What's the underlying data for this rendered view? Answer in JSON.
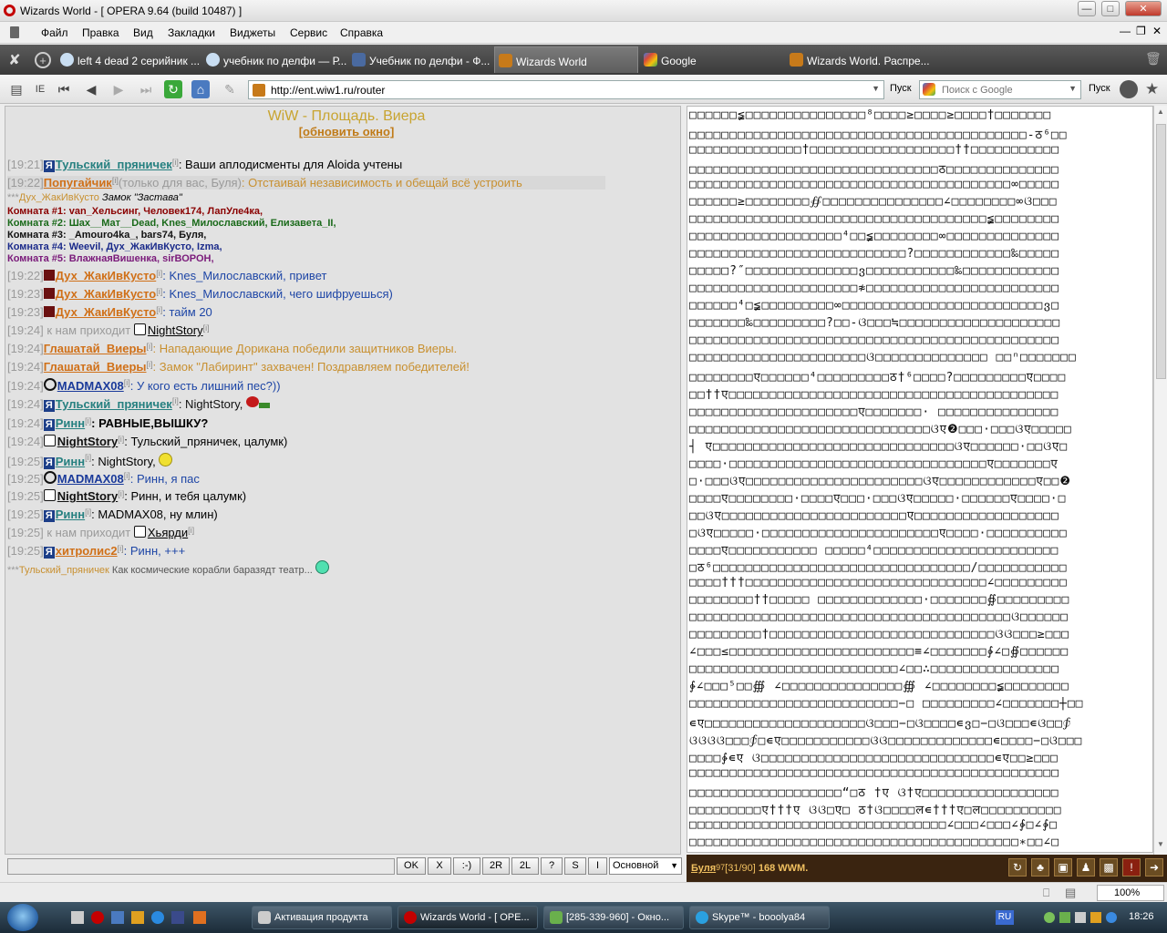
{
  "window": {
    "title": "Wizards World - [ OPERA 9.64 (build 10487) ]"
  },
  "menu": [
    "Файл",
    "Правка",
    "Вид",
    "Закладки",
    "Виджеты",
    "Сервис",
    "Справка"
  ],
  "tabs": [
    {
      "label": "left 4 dead 2 серийник ..."
    },
    {
      "label": "учебник по делфи — Р..."
    },
    {
      "label": "Учебник по делфи - Ф..."
    },
    {
      "label": "Wizards World"
    },
    {
      "label": "Google"
    },
    {
      "label": "Wizards World. Распре..."
    }
  ],
  "toolbar": {
    "ie_label": "IE",
    "url": "http://ent.wiw1.ru/router",
    "go_label": "Пуск",
    "search_placeholder": "Поиск с Google",
    "search_go": "Пуск"
  },
  "chat": {
    "location": "WiW - Площадь. Виера",
    "refresh": "[обновить окно]",
    "lines": [
      {
        "time": "[19:21]",
        "nick": "Тульский_пряничек",
        "text": ": Ваши аплодисменты для Aloida учтены"
      },
      {
        "time": "[19:22]",
        "nick": "Попугайчик",
        "private": "(только для вас, Буля)",
        "text": ": Отстаивай независимость и обещай всё устроить"
      },
      {
        "time": "[19:22]",
        "nick": "Дух_ЖакИвКусто",
        "text": ": Knes_Милославский, привет"
      },
      {
        "time": "[19:23]",
        "nick": "Дух_ЖакИвКусто",
        "text": ": Knes_Милославский, чего шифруешься)"
      },
      {
        "time": "[19:23]",
        "nick": "Дух_ЖакИвКусто",
        "text": ": тайм 20"
      },
      {
        "time": "[19:24]",
        "text": " к нам приходит ",
        "nick": "NightStory"
      },
      {
        "time": "[19:24]",
        "nick": "Глашатай_Виеры",
        "text": ": Нападающие Дорикана победили защитников Виеры."
      },
      {
        "time": "[19:24]",
        "nick": "Глашатай_Виеры",
        "text": ": Замок \"Лабиринт\" захвачен! Поздравляем победителей!"
      },
      {
        "time": "[19:24]",
        "nick": "MADMAX08",
        "text": ": У кого есть лишний пес?))"
      },
      {
        "time": "[19:24]",
        "nick": "Тульский_пряничек",
        "text": ": NightStory,"
      },
      {
        "time": "[19:24]",
        "nick": "Ринн",
        "text": ": РАВНЫЕ,ВЫШКУ?"
      },
      {
        "time": "[19:24]",
        "nick": "NightStory",
        "text": ": Тульский_пряничек, цалумк)"
      },
      {
        "time": "[19:25]",
        "nick": "Ринн",
        "text": ": NightStory,"
      },
      {
        "time": "[19:25]",
        "nick": "MADMAX08",
        "text": ": Ринн, я пас"
      },
      {
        "time": "[19:25]",
        "nick": "NightStory",
        "text": ": Ринн, и тебя цалумк)"
      },
      {
        "time": "[19:25]",
        "nick": "Ринн",
        "text": ": MADMAX08, ну млин)"
      },
      {
        "time": "[19:25]",
        "text": " к нам приходит ",
        "nick": "Хьярди"
      },
      {
        "time": "[19:25]",
        "nick": "хитролис2",
        "text": ": Ринн, +++"
      }
    ],
    "sup": "[i]",
    "castle_nick": "Дух_ЖакИвКусто",
    "castle_text": "Замок \"Застава\"",
    "stars": "***",
    "rooms": [
      "Комната #1: van_Хельсинг, Человек174, ЛапУле4ка,",
      "Комната #2: Шах__Мат__Dead, Knes_Милославский, Елизавета_II,",
      "Комната #3: _Amouro4ka_, bars74, Буля,",
      "Комната #4: Weevil, Дух_ЖакИвКусто, Izma,",
      "Комната #5: ВлажнаяВишенка, sirВОРОН,"
    ],
    "space_nick": "Тульский_пряничек",
    "space_text": " Как космические корабли баразядт театр..."
  },
  "input_buttons": [
    "OK",
    "X",
    ":-)",
    "2R",
    "2L",
    "?",
    "S",
    "I"
  ],
  "channel": "Основной",
  "status": {
    "nick": "Буля",
    "level": "97",
    "hp": "[31/90]",
    "money": "168 WWM."
  },
  "zoom": "100%",
  "taskbar": {
    "tasks": [
      "Активация продукта",
      "Wizards World - [ OPE...",
      "[285-339-960] - Окно...",
      "Skype™ - booolya84"
    ],
    "lang": "RU",
    "clock": "18:26"
  },
  "garbage_rows": [
    "□□□□□□≨□□□□□□□□□□□□□□□⁸□□□□≥□□□□≥□□□□†□□□□□□□",
    "□□□□□□□□□□□□□□□□□□□□□□□□□□□□□□□□□□□□□□□□□□-ठ⁶□□",
    "□□□□□□□□□□□□□□†□□□□□□□□□□□□□□□□□□††□□□□□□□□□□□",
    "□□□□□□□□□□□□□□□□□□□□□□□□□□□□□□□ठ□□□□□□□□□□□□□□",
    "□□□□□□□□□□□□□□□□□□□□□□□□□□□□□□□□□□□□□□□□∞□□□□□",
    "□□□□□□≥□□□□□□□□∯□□□□□□□□□□□□□□□∠□□□□□□□□∞ଓ□□□",
    "□□□□□□□□□□□□□□□□□□□□□□□□□□□□□□□□□□□□□≨□□□□□□□□",
    "□□□□□□□□□□□□□□□□□□□⁴□□≨□□□□□□□□∞□□□□□□□□□□□□□□",
    "□□□□□□□□□□□□□□□□□□□□□□□□□□□?□□□□□□□□□□□□‰□□□□□",
    "□□□□□?″□□□□□□□□□□□□□□ვ□□□□□□□□□□□‰□□□□□□□□□□□□",
    "□□□□□□□□□□□□□□□□□□□□□≉□□□□□□□□□□□□□□□□□□□□□□□□",
    "□□□□□□⁴□≨□□□□□□□□□∞□□□□□□□□□□□□□□□□□□□□□□□□□ვ□",
    "□□□□□□□‰□□□□□□□□□?□□-ଓ□□□≒□□□□□□□□□□□□□□□□□□□□",
    "□□□□□□□□□□□□□□□□□□□□□□□□□□□□□□□□□□□□□□□□□□□□□□",
    "□□□□□□□□□□□□□□□□□□□□□□ଓ□□□□□□□□□□□□□□ □□ⁿ□□□□□□□",
    "□□□□□□□□ए□□□□□□⁴□□□□□□□□□ठ†⁶□□□□?□□□□□□□□□ए□□□□",
    "□□††ए□□□□□□□□□□□□□□□□□□□□□□□□□□□□□□□□□□□□□□□□□",
    "□□□□□□□□□□□□□□□□□□□□□ए□□□□□□□· □□□□□□□□□□□□□□□",
    "□□□□□□□□□□□□□□□□□□□□□□□□□□□□□□ଓए❷□□□·□□□ଓए□□□□□",
    "┤ ए□□□□□□□□□□□□□□□□□□□□□□□□□□□□□□ଓए□□□□□□·□□ଓए□",
    "□□□□·□□□□□□□□□□□□□□□□□□□□□□□□□□□□□□□□ए□□□□□□□ए",
    "□·□□□ଓए□□□□□□□□□□□□□□□□□□□□□□ଓए□□□□□□□□□□□□ए□□❷",
    "□□□□ए□□□□□□□□·□□□□ए□□□·□□□ଓए□□□□□·□□□□□□ए□□□□·□",
    "□□ଓए□□□□□□□□□□□□□□□□□□□□□□□ए□□□□□□□□□□□□□□□□□□",
    "□ଓए□□□□□·□□□□□□□□□□□□□□□□□□□□□□ए□□□□·□□□□□□□□□□",
    "□□□□ए□□□□□□□□□□□ □□□□□⁴□□□□□□□□□□□□□□□□□□□□□□□",
    "□ठ⁶□□□□□□□□□□□□□□□□□□□□□□□□□□□□□□□□/□□□□□□□□□□□",
    "□□□□†††□□□□□□□□□□□□□□□□□□□□□□□□□□□□□□∠□□□□□□□□□",
    "□□□□□□□□††□□□□□ □□□□□□□□□□□□□·□□□□□□□∯□□□□□□□□□",
    "□□□□□□□□□□□□□□□□□□□□□□□□□□□□□□□□□□□□□□□□ଓ□□□□□□",
    "□□□□□□□□□†□□□□□□□□□□□□□□□□□□□□□□□□□□□□ଓଓ□□□≥□□□",
    "∠□□□≤□□□□□□□□□□□□□□□□□□□□□□□≡∠□□□□□□□∳∠□∯□□□□□□",
    "□□□□□□□□□□□□□□□□□□□□□□□□□□∠□□∴□□□□□□□□□□□□□□□□",
    "∳∠□□□⁵□□∰ ∠□□□□□□□□□□□□□□□∰ ∠□□□□□□□□≨□□□□□□□□",
    "□□□□□□□□□□□□□□□□□□□□□□□□□□−□ □□□□□□□□□∠□□□□□□□┼□□",
    "∊ए□□□□□□□□□□□□□□□□□□□□ଓ□□□−□ଓ□□□□∊ვ□−□ଓ□□□∊ଓ□□∳",
    "ଓଓଓଓ□□□∳□∊ए□□□□□□□□□□□ଓଓ□□□□□□□□□□□□□∊□□□□−□ଓ□□□",
    "□□□□∳∊ए ଓ□□□□□□□□□□□□□□□□□□□□□□□□□□□□□∊ए□□≥□□□",
    "□□□□□□□□□□□□□□□□□□□□□□□□□□□□□□□□□□□□□□□□□□□□□□",
    "□□□□□□□□□□□□□□□□□□□“□ठ †ए ଓ†ए□□□□□□□□□□□□□□□□□",
    "□□□□□□□□□ए†††ए ଓଓ□ए□ ठ†ଓ□□□□ल∊†††ए□ल□□□□□□□□□□",
    "□□□□□□□□□□□□□□□□□□□□□□□□□□□□□□□□∠□□□∠□□□∠∳□∠∳□",
    "□□□□□□□□□□□□□□□□□□□□□□□□□□□□□□□□□□□□□□□□□∗□□∠□"
  ]
}
